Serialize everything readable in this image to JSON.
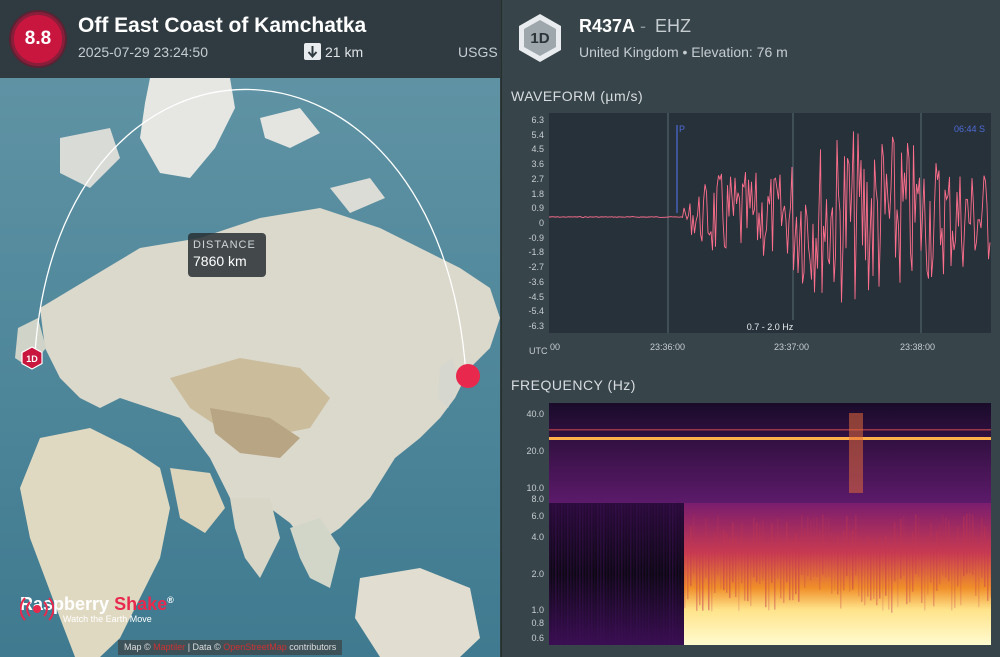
{
  "event": {
    "magnitude": "8.8",
    "title": "Off East Coast of Kamchatka",
    "datetime": "2025-07-29 23:24:50",
    "depth": "21 km",
    "source": "USGS"
  },
  "map": {
    "distance_label": "DISTANCE",
    "distance_value": "7860 km",
    "station_marker": "1D",
    "logo_name_a": "Raspberry",
    "logo_name_b": "Shake",
    "logo_reg": "®",
    "logo_tagline": "Watch the Earth Move",
    "attribution_a": "Map ©",
    "attribution_link_a": "Maptiler",
    "attribution_b": "| Data ©",
    "attribution_link_b": "OpenStreetMap",
    "attribution_c": "contributors"
  },
  "station": {
    "badge": "1D",
    "code": "R437A",
    "separator": "-",
    "channel": "EHZ",
    "location": "United Kingdom • Elevation: 76 m"
  },
  "waveform": {
    "title": "WAVEFORM (µm/s)",
    "yticks": [
      "6.3",
      "5.4",
      "4.5",
      "3.6",
      "2.7",
      "1.8",
      "0.9",
      "0",
      "-0.9",
      "-1.8",
      "-2.7",
      "-3.6",
      "-4.5",
      "-5.4",
      "-6.3"
    ],
    "xtick_utc": "UTC",
    "xticks": [
      "00",
      "23:36:00",
      "23:37:00",
      "23:38:00"
    ],
    "p_marker": "P",
    "s_marker": "06:44 S",
    "filter": "0.7 - 2.0 Hz"
  },
  "frequency": {
    "title": "FREQUENCY (Hz)",
    "yticks": [
      "40.0",
      "20.0",
      "10.0",
      "8.0",
      "6.0",
      "4.0",
      "2.0",
      "1.0",
      "0.8",
      "0.6"
    ]
  },
  "colors": {
    "magnitude_badge": "#c9163f",
    "quake_marker": "#e8294d",
    "waveform_line": "#ff6f8d",
    "panel_bg": "#26313a"
  }
}
